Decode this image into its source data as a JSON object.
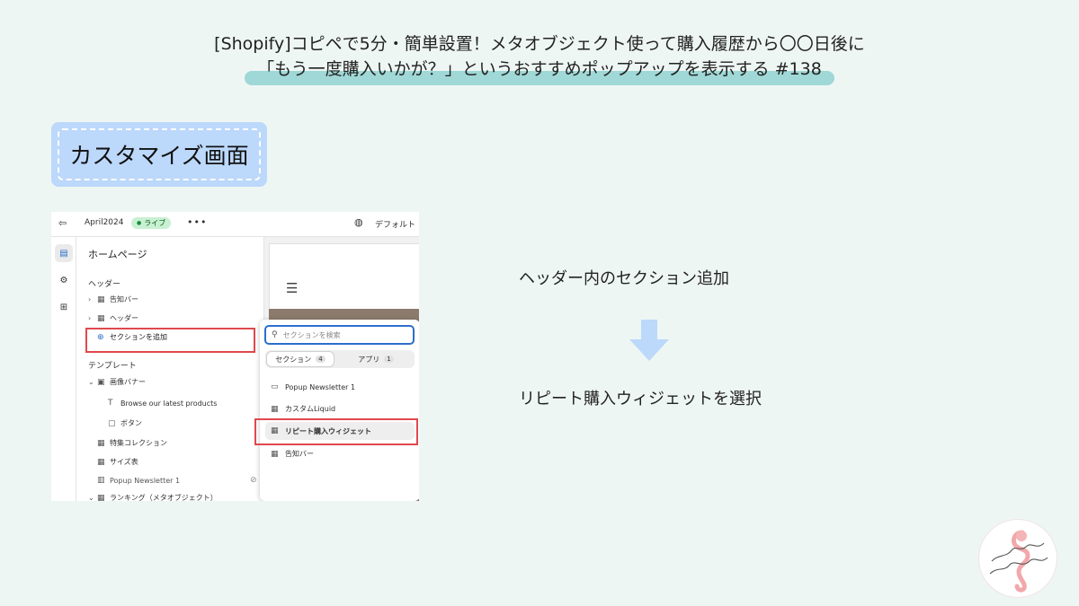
{
  "title": {
    "line1": "[Shopify]コピペで5分・簡単設置！メタオブジェクト使って購入履歴から〇〇日後に",
    "line2": "「もう一度購入いかが？」というおすすめポップアップを表示する #138"
  },
  "badge": "カスタマイズ画面",
  "editor": {
    "theme_name": "April2024",
    "live_badge": "ライブ",
    "more": "•••",
    "default_label": "デフォルト",
    "panel_title": "ホームページ",
    "header_group": "ヘッダー",
    "header_items": [
      "告知バー",
      "ヘッダー"
    ],
    "add_section": "セクションを追加",
    "template_group": "テンプレート",
    "image_banner": "画像バナー",
    "banner_children": [
      "Browse our latest products",
      "ボタン"
    ],
    "template_items": [
      "特集コレクション",
      "サイズ表",
      "Popup Newsletter 1",
      "ランキング（メタオブジェクト）"
    ]
  },
  "popup": {
    "search_placeholder": "セクションを検索",
    "tab_sections": "セクション",
    "tab_sections_count": "4",
    "tab_apps": "アプリ",
    "tab_apps_count": "1",
    "items": [
      "Popup Newsletter 1",
      "カスタムLiquid",
      "リピート購入ウィジェット",
      "告知バー"
    ]
  },
  "steps": {
    "step1": "ヘッダー内のセクション追加",
    "step2": "リピート購入ウィジェットを選択"
  },
  "colors": {
    "highlight": "#9fd8d6",
    "badge_bg": "#bcd8fb",
    "arrow": "#bcd8fb",
    "red_box": "#e0484d",
    "focus_blue": "#2c6ecb"
  }
}
